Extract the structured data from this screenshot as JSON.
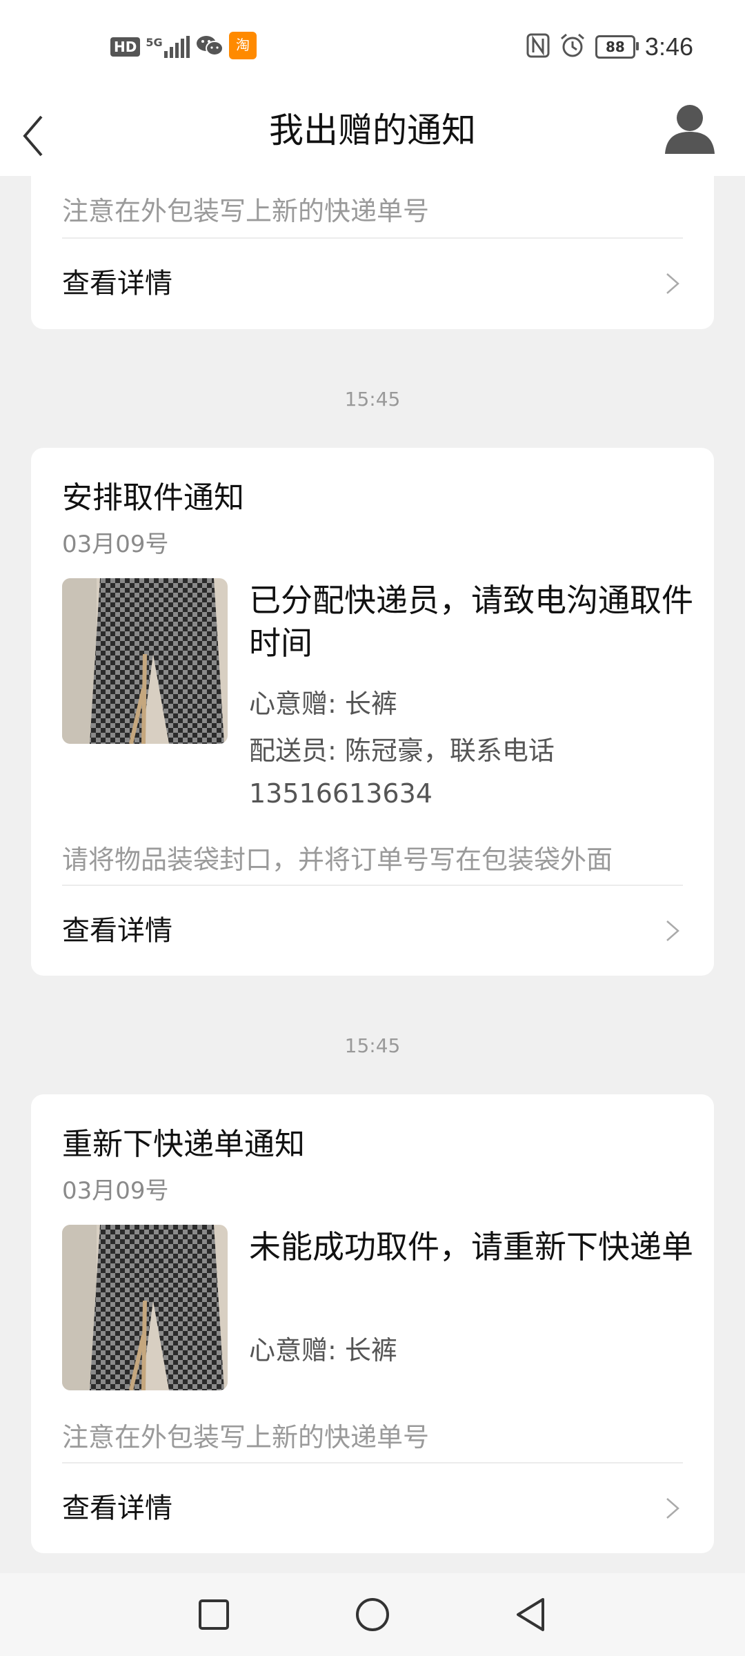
{
  "status_bar": {
    "hd": "HD",
    "network": "5G",
    "battery": "88",
    "time": "3:46"
  },
  "header": {
    "title": "我出赠的通知"
  },
  "partial_card": {
    "note": "注意在外包装写上新的快递单号",
    "detail_label": "查看详情"
  },
  "notifications": [
    {
      "timestamp": "15:45",
      "title": "安排取件通知",
      "date": "03月09号",
      "message": "已分配快递员，请致电沟通取件时间",
      "gift": "心意赠: 长裤",
      "courier": "配送员: 陈冠豪，联系电话 13516613634",
      "note": "请将物品装袋封口，并将订单号写在包装袋外面",
      "detail_label": "查看详情"
    },
    {
      "timestamp": "15:45",
      "title": "重新下快递单通知",
      "date": "03月09号",
      "message": "未能成功取件，请重新下快递单",
      "gift": "心意赠: 长裤",
      "note": "注意在外包装写上新的快递单号",
      "detail_label": "查看详情"
    }
  ],
  "icons": {
    "back": "chevron-left-icon",
    "profile": "user-icon",
    "detail": "chevron-right-icon",
    "nav_recent": "square-icon",
    "nav_home": "circle-icon",
    "nav_back": "triangle-back-icon"
  }
}
